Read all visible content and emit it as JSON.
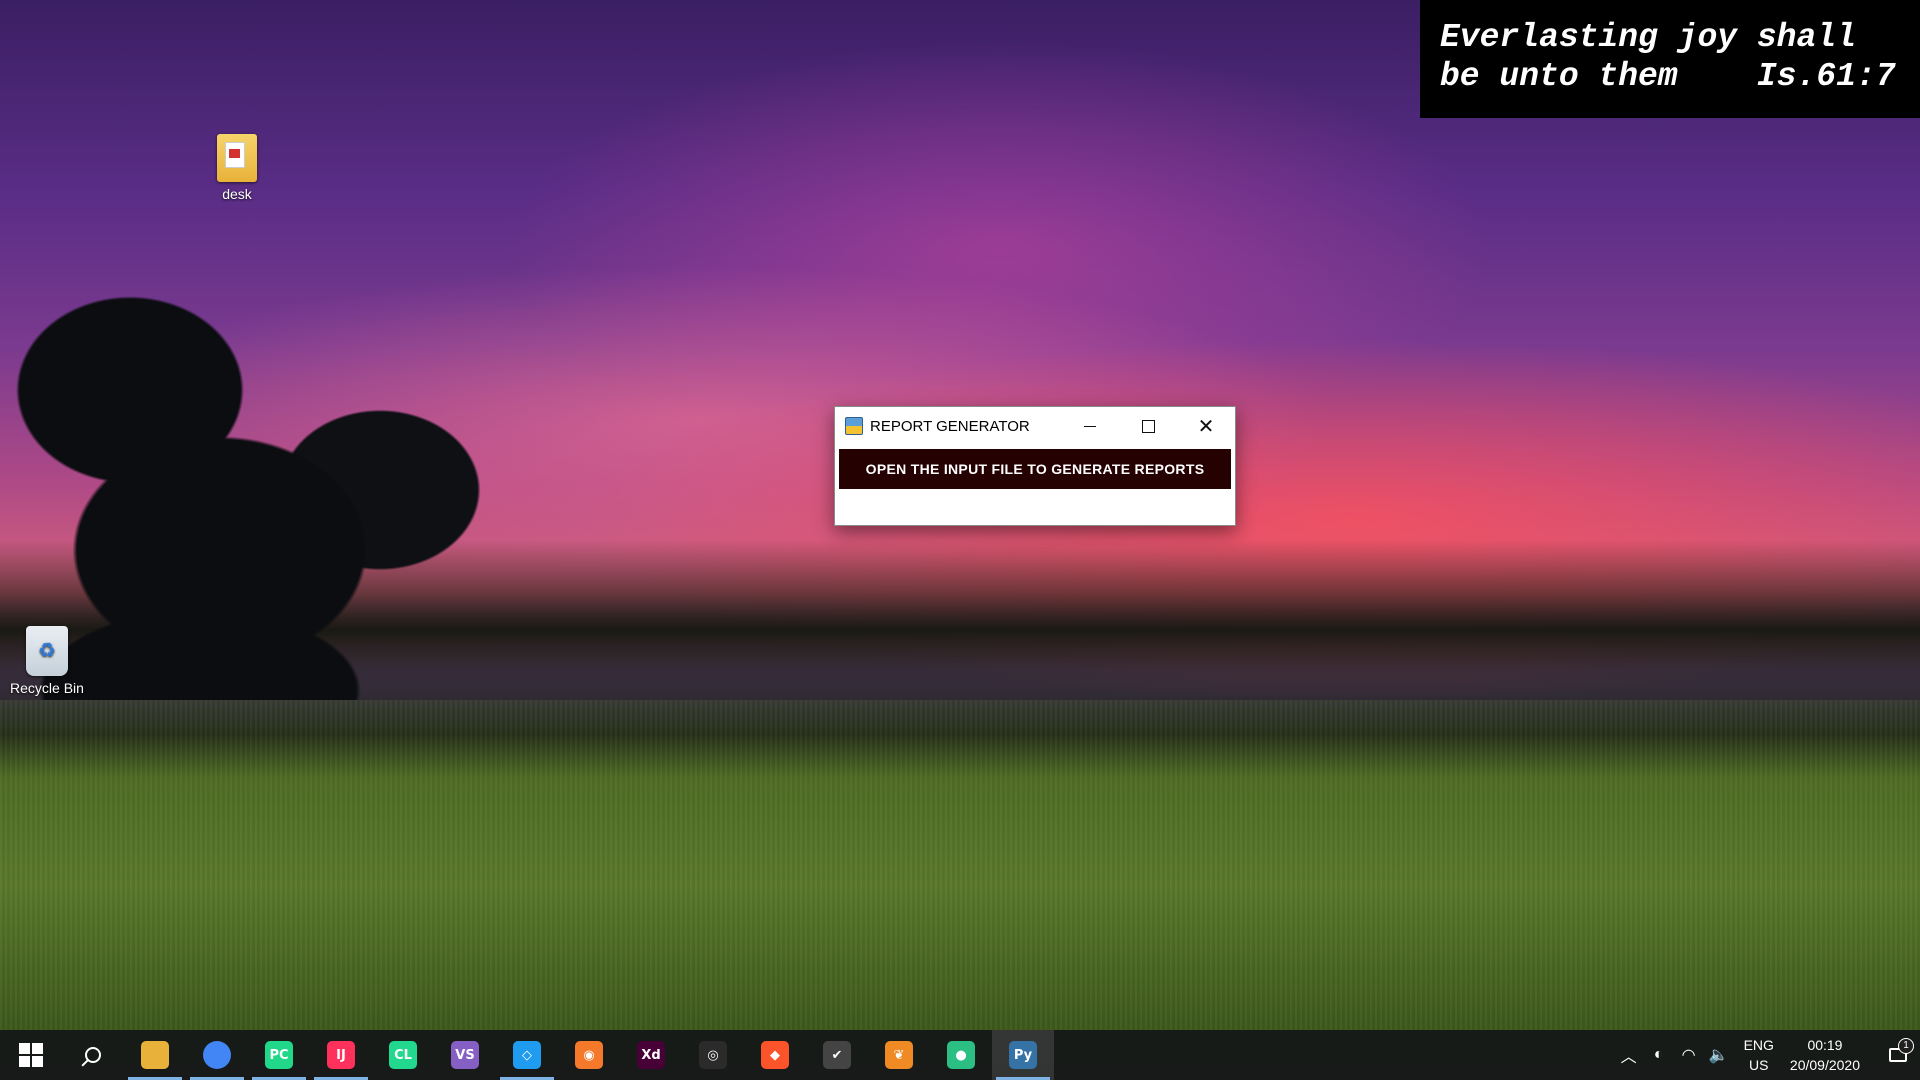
{
  "verse": {
    "line1": "Everlasting joy shall",
    "line2": "be unto them    Is.61:7"
  },
  "desktop_icons": [
    {
      "label": "desk",
      "icon": "folder-pdf-icon"
    },
    {
      "label": "Recycle Bin",
      "icon": "recycle-bin-icon"
    }
  ],
  "window": {
    "title": "REPORT GENERATOR",
    "button_label": "OPEN THE INPUT FILE TO GENERATE REPORTS",
    "button_color": "#260101"
  },
  "taskbar": {
    "apps": [
      {
        "name": "file-explorer",
        "glyph": "",
        "color": "#e8b23a"
      },
      {
        "name": "chrome",
        "glyph": "",
        "color": "#4285f4"
      },
      {
        "name": "pycharm",
        "glyph": "PC",
        "color": "#21d789"
      },
      {
        "name": "intellij",
        "glyph": "IJ",
        "color": "#fe315d"
      },
      {
        "name": "clion",
        "glyph": "CL",
        "color": "#22d88f"
      },
      {
        "name": "visual-studio",
        "glyph": "VS",
        "color": "#865fc5"
      },
      {
        "name": "vscode",
        "glyph": "◇",
        "color": "#1f9cf0"
      },
      {
        "name": "blender",
        "glyph": "◉",
        "color": "#f5792a"
      },
      {
        "name": "adobe-xd",
        "glyph": "Xd",
        "color": "#470137"
      },
      {
        "name": "obs",
        "glyph": "◎",
        "color": "#2b2b2b"
      },
      {
        "name": "brave",
        "glyph": "◆",
        "color": "#fb542b"
      },
      {
        "name": "app-check",
        "glyph": "✔",
        "color": "#444"
      },
      {
        "name": "fl-studio",
        "glyph": "❦",
        "color": "#f08a24"
      },
      {
        "name": "github-desktop",
        "glyph": "●",
        "color": "#2bbf83"
      },
      {
        "name": "python",
        "glyph": "Py",
        "color": "#3572a5"
      }
    ],
    "lang_top": "ENG",
    "lang_bottom": "US",
    "time": "00:19",
    "date": "20/09/2020",
    "notification_count": "1"
  }
}
